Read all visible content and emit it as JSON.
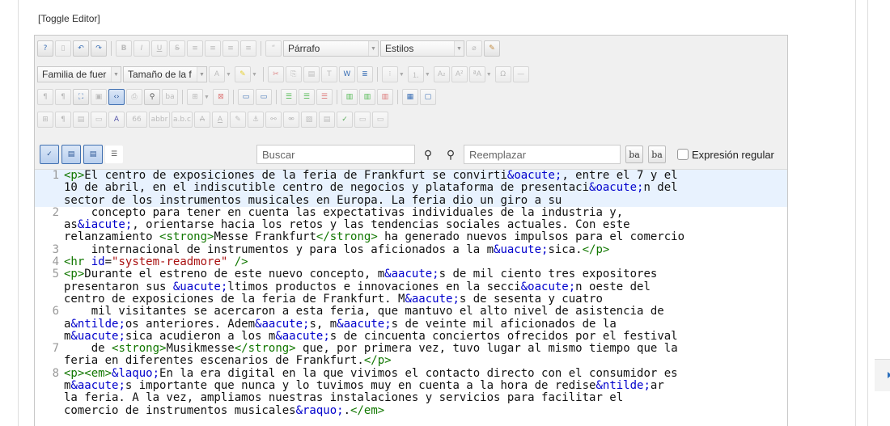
{
  "toggle_editor": "[Toggle Editor]",
  "toolbar": {
    "format_select": "Párrafo",
    "styles_select": "Estilos",
    "font_family_select": "Familia de fuer",
    "font_size_select": "Tamaño de la f"
  },
  "search": {
    "placeholder": "Buscar",
    "replace_placeholder": "Reemplazar",
    "regex_label": "Expresión regular"
  },
  "code": {
    "rows": [
      {
        "n": "1",
        "t": "<p>El centro de exposiciones de la feria de Frankfurt se convirti&oacute;, entre el 7 y el"
      },
      {
        "n": "",
        "t": "10 de abril, en el indiscutible centro de negocios y plataforma de presentaci&oacute;n del"
      },
      {
        "n": "",
        "t": "sector de los instrumentos musicales en Europa. La feria dio un giro a su"
      },
      {
        "n": "2",
        "t": "    concepto para tener en cuenta las expectativas individuales de la industria y,"
      },
      {
        "n": "",
        "t": "as&iacute;, orientarse hacia los retos y las tendencias sociales actuales. Con este"
      },
      {
        "n": "",
        "t": "relanzamiento <strong>Messe Frankfurt</strong> ha generado nuevos impulsos para el comercio"
      },
      {
        "n": "3",
        "t": "    internacional de instrumentos y para los aficionados a la m&uacute;sica.</p>"
      },
      {
        "n": "4",
        "t": "<hr id=\"system-readmore\" />"
      },
      {
        "n": "5",
        "t": "<p>Durante el estreno de este nuevo concepto, m&aacute;s de mil ciento tres expositores"
      },
      {
        "n": "",
        "t": "presentaron sus &uacute;ltimos productos e innovaciones en la secci&oacute;n oeste del"
      },
      {
        "n": "",
        "t": "centro de exposiciones de la feria de Frankfurt. M&aacute;s de sesenta y cuatro"
      },
      {
        "n": "6",
        "t": "    mil visitantes se acercaron a esta feria, que mantuvo el alto nivel de asistencia de"
      },
      {
        "n": "",
        "t": "a&ntilde;os anteriores. Adem&aacute;s, m&aacute;s de veinte mil aficionados de la"
      },
      {
        "n": "",
        "t": "m&uacute;sica acudieron a los m&aacute;s de cincuenta conciertos ofrecidos por el festival"
      },
      {
        "n": "7",
        "t": "    de <strong>Musikmesse</strong> que, por primera vez, tuvo lugar al mismo tiempo que la"
      },
      {
        "n": "",
        "t": "feria en diferentes escenarios de Frankfurt.</p>"
      },
      {
        "n": "8",
        "t": "<p><em>&laquo;En la era digital en la que vivimos el contacto directo con el consumidor es"
      },
      {
        "n": "",
        "t": "m&aacute;s importante que nunca y lo tuvimos muy en cuenta a la hora de redise&ntilde;ar"
      },
      {
        "n": "",
        "t": "la feria. A la vez, ampliamos nuestras instalaciones y servicios para facilitar el"
      },
      {
        "n": "",
        "t": "comercio de instrumentos musicales&raquo;.</em>"
      }
    ],
    "highlight_rows": 3
  }
}
